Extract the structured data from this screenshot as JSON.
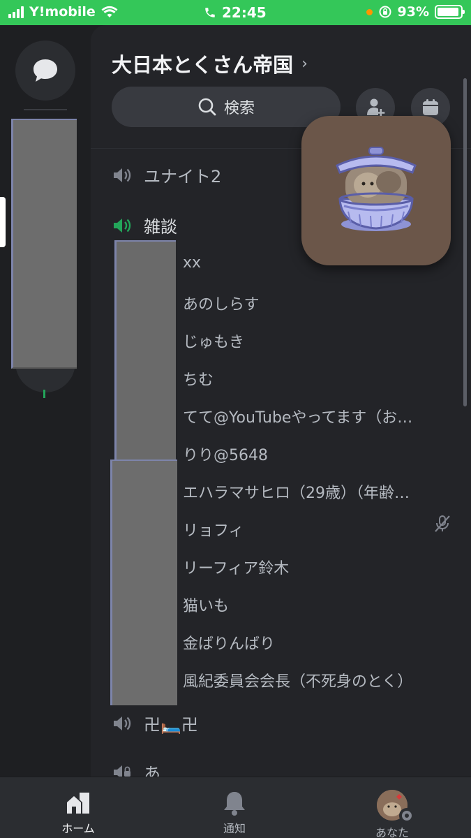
{
  "status_bar": {
    "carrier": "Y!mobile",
    "time": "22:45",
    "battery_percent": "93%",
    "battery_level": 0.93,
    "accent_color": "#34c759"
  },
  "server": {
    "name": "大日本とくさん帝国"
  },
  "search": {
    "label": "検索"
  },
  "channels": {
    "voice_1": {
      "name": "ユナイト2"
    },
    "voice_2": {
      "name": "雑談"
    },
    "voice_3": {
      "name": "卍🛏️卍"
    },
    "voice_4": {
      "name": "あ"
    }
  },
  "members": [
    {
      "name": "xx"
    },
    {
      "name": "あのしらす"
    },
    {
      "name": "じゅもき"
    },
    {
      "name": "ちむ"
    },
    {
      "name": "てて@YouTubeやってます（お…"
    },
    {
      "name": "りり@5648"
    },
    {
      "name": "エハラマサヒロ（29歳）（年齢…"
    },
    {
      "name": "リョフィ",
      "muted": true
    },
    {
      "name": "リーフィア鈴木"
    },
    {
      "name": "猫いも"
    },
    {
      "name": "金ばりんばり"
    },
    {
      "name": "風紀委員会会長（不死身のとく）"
    }
  ],
  "bottom_nav": {
    "home": "ホーム",
    "notifications": "通知",
    "you": "あなた"
  },
  "icons": [
    "chat-bubble-icon",
    "search-icon",
    "add-member-icon",
    "calendar-icon",
    "speaker-icon",
    "mic-muted-icon",
    "home-icon",
    "bell-icon",
    "wifi-icon",
    "phone-icon",
    "rotation-lock-icon"
  ]
}
